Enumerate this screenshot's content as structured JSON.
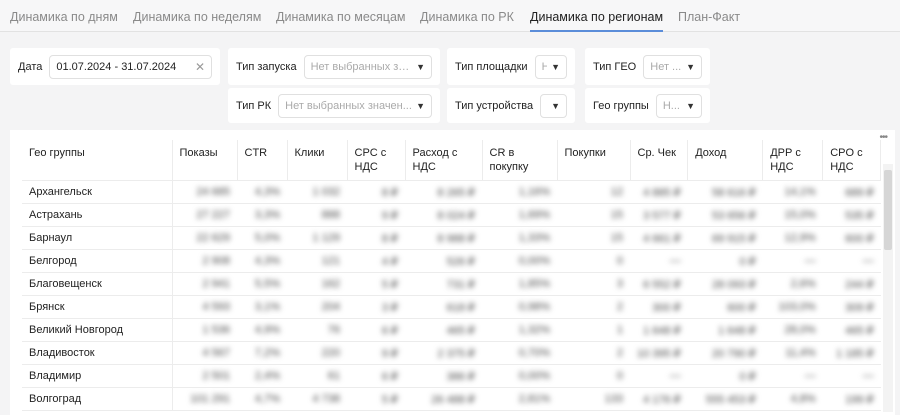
{
  "tabs": [
    "Динамика по дням",
    "Динамика по неделям",
    "Динамика по месяцам",
    "Динамика по РК",
    "Динамика по регионам",
    "План-Факт"
  ],
  "active_tab": "Динамика по регионам",
  "filters": {
    "date": {
      "label": "Дата",
      "value": "01.07.2024 - 31.07.2024"
    },
    "launch_type": {
      "label": "Тип запуска",
      "placeholder": "Нет выбранных зн..."
    },
    "platform_type": {
      "label": "Тип площадки",
      "placeholder": "Н"
    },
    "geo_type": {
      "label": "Тип ГЕО",
      "placeholder": "Нет ..."
    },
    "rk_type": {
      "label": "Тип РК",
      "placeholder": "Нет выбранных значен..."
    },
    "device_type": {
      "label": "Тип устройства",
      "placeholder": ""
    },
    "geo_groups": {
      "label": "Гео группы",
      "placeholder": "Н..."
    }
  },
  "table": {
    "columns": [
      "Гео группы",
      "Показы",
      "CTR",
      "Клики",
      "CPC с НДС",
      "Расход с НДС",
      "CR в покупку",
      "Покупки",
      "Ср. Чек",
      "Доход",
      "ДРР с НДС",
      "CPO с НДС"
    ],
    "rows": [
      [
        "Архангельск",
        "24 685",
        "4,3%",
        "1 032",
        "8 ₽",
        "8 265 ₽",
        "1,16%",
        "12",
        "4 885 ₽",
        "58 616 ₽",
        "14,1%",
        "689 ₽"
      ],
      [
        "Астрахань",
        "27 227",
        "3,3%",
        "888",
        "9 ₽",
        "8 024 ₽",
        "1,69%",
        "15",
        "3 577 ₽",
        "53 656 ₽",
        "15,0%",
        "535 ₽"
      ],
      [
        "Барнаул",
        "22 629",
        "5,0%",
        "1 129",
        "8 ₽",
        "8 988 ₽",
        "1,33%",
        "15",
        "4 661 ₽",
        "69 915 ₽",
        "12,9%",
        "600 ₽"
      ],
      [
        "Белгород",
        "2 908",
        "4,3%",
        "121",
        "4 ₽",
        "526 ₽",
        "0,00%",
        "0",
        "—",
        "0 ₽",
        "—",
        "—"
      ],
      [
        "Благовещенск",
        "2 941",
        "5,5%",
        "162",
        "5 ₽",
        "731 ₽",
        "1,85%",
        "3",
        "6 552 ₽",
        "28 093 ₽",
        "2,6%",
        "244 ₽"
      ],
      [
        "Брянск",
        "4 593",
        "3,1%",
        "204",
        "3 ₽",
        "618 ₽",
        "0,98%",
        "2",
        "300 ₽",
        "600 ₽",
        "103,0%",
        "309 ₽"
      ],
      [
        "Великий Новгород",
        "1 536",
        "4,9%",
        "76",
        "6 ₽",
        "465 ₽",
        "1,32%",
        "1",
        "1 648 ₽",
        "1 648 ₽",
        "28,0%",
        "465 ₽"
      ],
      [
        "Владивосток",
        "4 567",
        "7,2%",
        "220",
        "9 ₽",
        "2 375 ₽",
        "0,70%",
        "2",
        "10 395 ₽",
        "20 790 ₽",
        "11,4%",
        "1 185 ₽"
      ],
      [
        "Владимир",
        "2 501",
        "2,4%",
        "61",
        "6 ₽",
        "386 ₽",
        "0,00%",
        "0",
        "—",
        "0 ₽",
        "—",
        "—"
      ],
      [
        "Волгоград",
        "101 291",
        "4,7%",
        "4 738",
        "5 ₽",
        "26 488 ₽",
        "2,81%",
        "133",
        "4 176 ₽",
        "555 453 ₽",
        "4,8%",
        "199 ₽"
      ]
    ]
  },
  "more_icon": "ellipsis-icon",
  "accent": "#5b8dd9"
}
